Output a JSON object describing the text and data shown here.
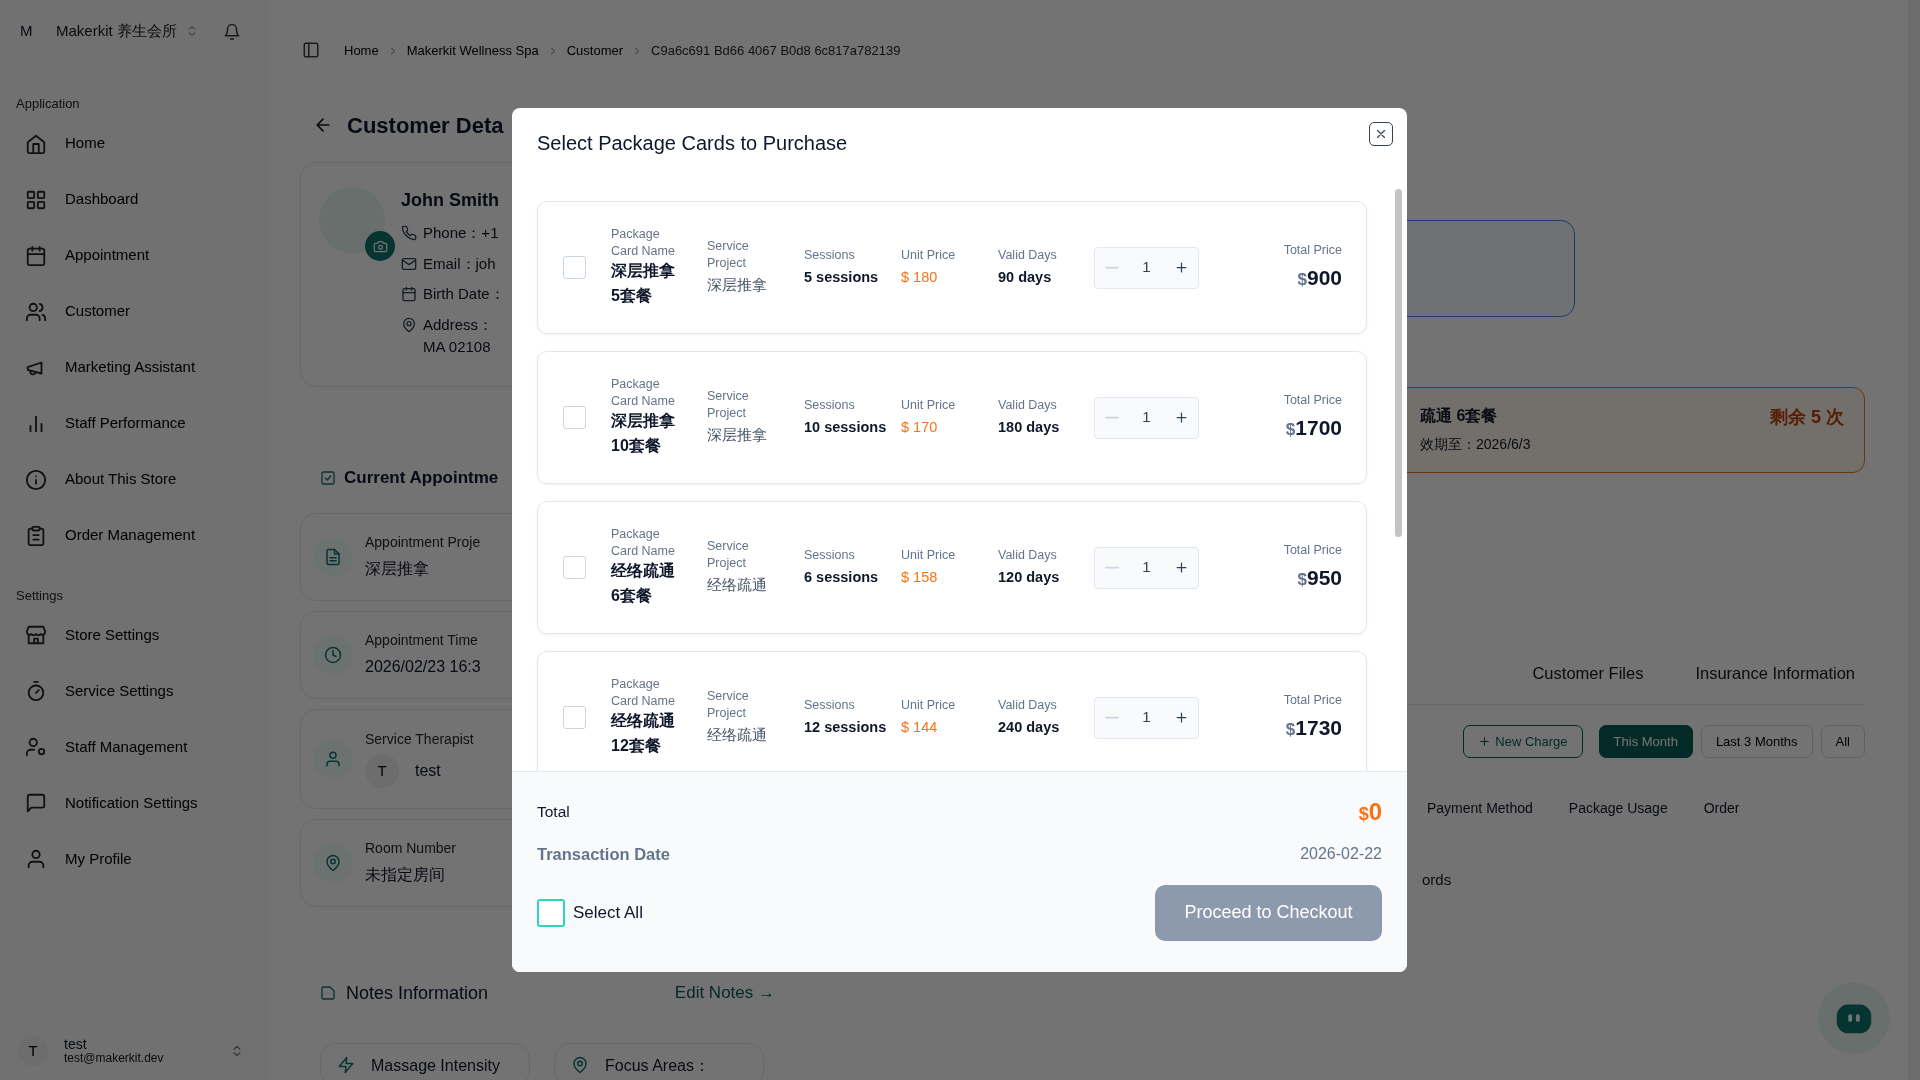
{
  "sidebar": {
    "workspace_initial": "M",
    "workspace": "Makerkit 养生会所",
    "sections": [
      {
        "title": "Application",
        "items": [
          {
            "label": "Home"
          },
          {
            "label": "Dashboard"
          },
          {
            "label": "Appointment"
          },
          {
            "label": "Customer"
          },
          {
            "label": "Marketing Assistant"
          },
          {
            "label": "Staff Performance"
          },
          {
            "label": "About This Store"
          },
          {
            "label": "Order Management"
          }
        ]
      },
      {
        "title": "Settings",
        "items": [
          {
            "label": "Store Settings"
          },
          {
            "label": "Service Settings"
          },
          {
            "label": "Staff Management"
          },
          {
            "label": "Notification Settings"
          },
          {
            "label": "My Profile"
          }
        ]
      }
    ],
    "user": {
      "initial": "T",
      "name": "test",
      "email": "test@makerkit.dev"
    }
  },
  "breadcrumb": [
    "Home",
    "Makerkit Wellness Spa",
    "Customer",
    "C9a6c691 Bd66 4067 B0d8 6c817a782139"
  ],
  "page": {
    "title": "Customer Deta",
    "profile": {
      "name": "John Smith",
      "fields": [
        {
          "lines": [
            "Phone：+1"
          ]
        },
        {
          "lines": [
            "Email：joh"
          ]
        },
        {
          "lines": [
            "Birth Date："
          ]
        },
        {
          "lines": [
            "Address：",
            "MA 02108"
          ]
        }
      ]
    },
    "appointment": {
      "title": "Current Appointme",
      "items": [
        {
          "kind": "text",
          "label": "Appointment Proje",
          "value": "深层推拿"
        },
        {
          "kind": "text",
          "label": "Appointment Time",
          "value": "2026/02/23 16:3"
        },
        {
          "kind": "person",
          "label": "Service Therapist",
          "initial": "T",
          "value": "test"
        },
        {
          "kind": "text",
          "label": "Room Number",
          "value": "未指定房间"
        }
      ]
    },
    "notes": {
      "title": "Notes Information",
      "edit": "Edit Notes →",
      "fields": [
        {
          "text": "Massage Intensity"
        },
        {
          "text": "Focus Areas："
        }
      ]
    },
    "package_card": {
      "name": "疏通 6套餐",
      "expiry": "效期至：2026/6/3",
      "remaining": "剩余 5 次"
    },
    "tabs": [
      "Customer Files",
      "Insurance Information"
    ],
    "new_charge": "New Charge",
    "filters": [
      {
        "label": "This Month",
        "selected": true
      },
      {
        "label": "Last 3 Months",
        "selected": false
      },
      {
        "label": "All",
        "selected": false
      }
    ],
    "table_columns": [
      "Payment Method",
      "Package Usage",
      "Order"
    ],
    "empty_text": "ords"
  },
  "modal": {
    "title": "Select Package Cards to Purchase",
    "packages": [
      {
        "checked": false,
        "labels": {
          "name": "Package Card Name",
          "project": "Service Project",
          "sessions": "Sessions",
          "unit_price": "Unit Price",
          "valid_days": "Valid Days",
          "total_price": "Total Price"
        },
        "name": "深层推拿5套餐",
        "project": "深层推拿",
        "sessions": "5 sessions",
        "unit_price": "$ 180",
        "valid_days": "90 days",
        "quantity": "1",
        "decrement_disabled": true,
        "currency": "$",
        "total_price": "900"
      },
      {
        "checked": false,
        "labels": {
          "name": "Package Card Name",
          "project": "Service Project",
          "sessions": "Sessions",
          "unit_price": "Unit Price",
          "valid_days": "Valid Days",
          "total_price": "Total Price"
        },
        "name": "深层推拿10套餐",
        "project": "深层推拿",
        "sessions": "10 sessions",
        "unit_price": "$ 170",
        "valid_days": "180 days",
        "quantity": "1",
        "decrement_disabled": true,
        "currency": "$",
        "total_price": "1700"
      },
      {
        "checked": false,
        "labels": {
          "name": "Package Card Name",
          "project": "Service Project",
          "sessions": "Sessions",
          "unit_price": "Unit Price",
          "valid_days": "Valid Days",
          "total_price": "Total Price"
        },
        "name": "经络疏通6套餐",
        "project": "经络疏通",
        "sessions": "6 sessions",
        "unit_price": "$ 158",
        "valid_days": "120 days",
        "quantity": "1",
        "decrement_disabled": true,
        "currency": "$",
        "total_price": "950"
      },
      {
        "checked": false,
        "labels": {
          "name": "Package Card Name",
          "project": "Service Project",
          "sessions": "Sessions",
          "unit_price": "Unit Price",
          "valid_days": "Valid Days",
          "total_price": "Total Price"
        },
        "name": "经络疏通12套餐",
        "project": "经络疏通",
        "sessions": "12 sessions",
        "unit_price": "$ 144",
        "valid_days": "240 days",
        "quantity": "1",
        "decrement_disabled": true,
        "currency": "$",
        "total_price": "1730"
      }
    ],
    "total_label": "Total",
    "total_currency": "$",
    "total": "0",
    "date_label": "Transaction Date",
    "date": "2026-02-22",
    "select_all": {
      "label": "Select All",
      "checked": false
    },
    "checkout": {
      "label": "Proceed to Checkout",
      "disabled": true
    }
  }
}
